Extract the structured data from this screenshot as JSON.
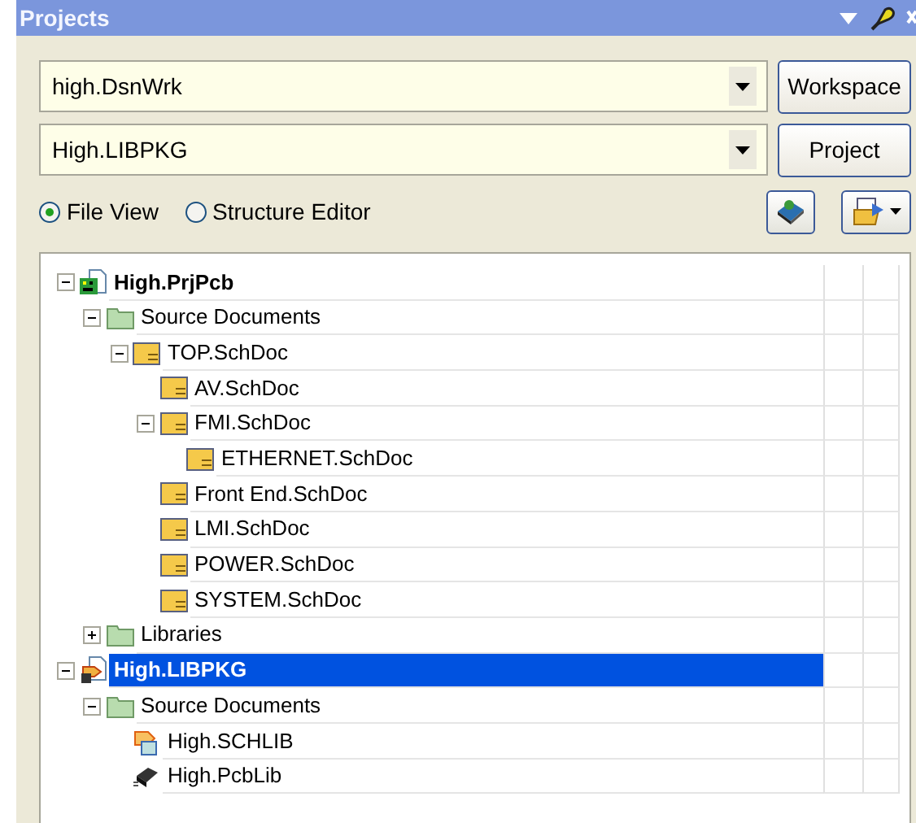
{
  "panel": {
    "title": "Projects"
  },
  "workspace_combo": {
    "value": "high.DsnWrk"
  },
  "workspace_button": "Workspace",
  "project_combo": {
    "value": "High.LIBPKG"
  },
  "project_button": "Project",
  "view_options": [
    {
      "label": "File View",
      "selected": true
    },
    {
      "label": "Structure Editor",
      "selected": false
    }
  ],
  "tree": [
    {
      "kind": "project",
      "label": "High.PrjPcb",
      "expanded": true,
      "selected": false,
      "children": [
        {
          "kind": "folder",
          "label": "Source Documents",
          "expanded": true,
          "selected": false,
          "children": [
            {
              "kind": "schdoc",
              "label": "TOP.SchDoc",
              "expanded": true,
              "selected": false,
              "children": [
                {
                  "kind": "schdoc",
                  "label": "AV.SchDoc",
                  "selected": false
                },
                {
                  "kind": "schdoc",
                  "label": "FMI.SchDoc",
                  "expanded": true,
                  "selected": false,
                  "children": [
                    {
                      "kind": "schdoc",
                      "label": "ETHERNET.SchDoc",
                      "selected": false
                    }
                  ]
                },
                {
                  "kind": "schdoc",
                  "label": "Front End.SchDoc",
                  "selected": false
                },
                {
                  "kind": "schdoc",
                  "label": "LMI.SchDoc",
                  "selected": false
                },
                {
                  "kind": "schdoc",
                  "label": "POWER.SchDoc",
                  "selected": false
                },
                {
                  "kind": "schdoc",
                  "label": "SYSTEM.SchDoc",
                  "selected": false
                }
              ]
            }
          ]
        },
        {
          "kind": "folder",
          "label": "Libraries",
          "expanded": false,
          "selected": false
        }
      ]
    },
    {
      "kind": "libpkg",
      "label": "High.LIBPKG",
      "expanded": true,
      "selected": true,
      "children": [
        {
          "kind": "folder",
          "label": "Source Documents",
          "expanded": true,
          "selected": false,
          "children": [
            {
              "kind": "schlib",
              "label": "High.SCHLIB",
              "selected": false
            },
            {
              "kind": "pcblib",
              "label": "High.PcbLib",
              "selected": false
            }
          ]
        }
      ]
    }
  ]
}
